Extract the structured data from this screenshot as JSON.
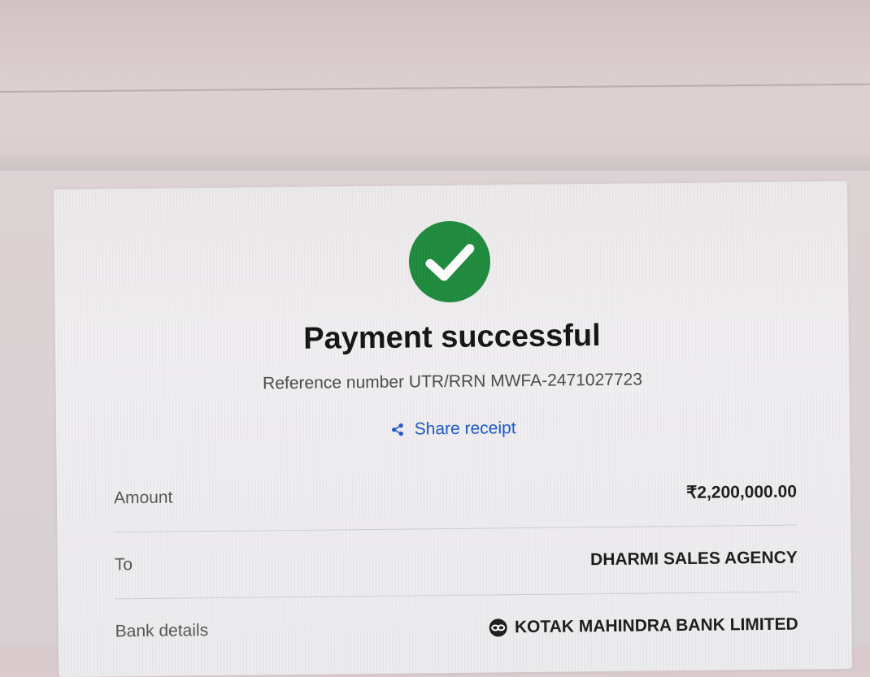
{
  "status": {
    "icon": "check-circle-icon",
    "color": "#1e8a3c",
    "title": "Payment successful",
    "reference": "Reference number UTR/RRN MWFA-2471027723"
  },
  "actions": {
    "share_icon": "share-icon",
    "share_label": "Share receipt",
    "link_color": "#1a57c9"
  },
  "details": [
    {
      "label": "Amount",
      "value": "₹2,200,000.00"
    },
    {
      "label": "To",
      "value": "DHARMI SALES AGENCY"
    },
    {
      "label": "Bank details",
      "value": "KOTAK MAHINDRA BANK LIMITED",
      "icon": "kotak-bank-logo-icon"
    }
  ]
}
